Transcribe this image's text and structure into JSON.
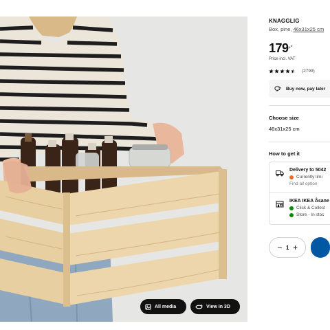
{
  "product": {
    "name": "KNAGGLIG",
    "description_prefix": "Box, pine, ",
    "description_measure": "46x31x25 cm",
    "price_integer": "179",
    "price_decimal": ",-",
    "price_note": "Price incl. VAT",
    "rating": 4.5,
    "rating_count": "(2799)"
  },
  "bnpl": {
    "label": "Buy now, pay later",
    "icon": "piggy-bank-icon"
  },
  "size": {
    "title": "Choose size",
    "selected": "46x31x25 cm"
  },
  "how_to_get": {
    "title": "How to get it",
    "delivery": {
      "title": "Delivery to 5042",
      "icon": "truck-icon",
      "status": "Currently limi",
      "status_color": "#f26a21",
      "link": "Find all option"
    },
    "store": {
      "title": "IKEA IKEA Åsane",
      "icon": "store-icon",
      "click_collect": "Click & Collect",
      "store_stock": "Store - In stoc",
      "status_color": "#0a8a00"
    }
  },
  "quantity": {
    "value": "1",
    "decrement": "−",
    "increment": "+"
  },
  "media": {
    "all_media_label": "All media",
    "view_3d_label": "View in 3D"
  },
  "colors": {
    "accent_blue": "#0058a3",
    "star": "#111111"
  }
}
